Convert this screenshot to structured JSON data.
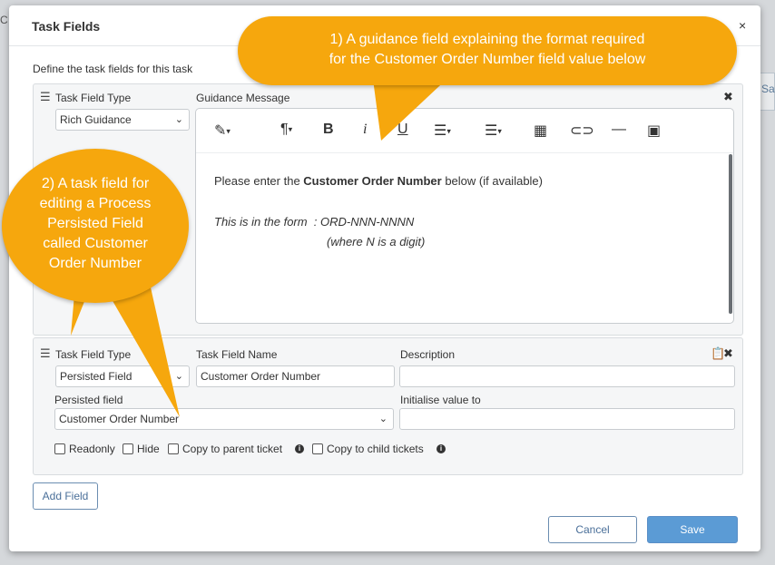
{
  "modal": {
    "title": "Task Fields",
    "close": "×",
    "intro": "Define the task fields for this task"
  },
  "background": {
    "left_char": "C",
    "right_char": "Sa"
  },
  "field1": {
    "type_label": "Task Field Type",
    "type_value": "Rich Guidance",
    "guidance_label": "Guidance Message",
    "editor_lines": [
      {
        "pre": "Please enter the ",
        "bold": "Customer Order Number",
        "post": " below (if available)"
      },
      {
        "text": "This is in the form  : ORD-NNN-NNNN"
      },
      {
        "text": "(where N is a digit)"
      }
    ]
  },
  "toolbar": {
    "items": [
      "pencil-dropdown",
      "paragraph-dropdown",
      "bold",
      "italic",
      "underline",
      "ordered-list",
      "bullet-list",
      "table",
      "link",
      "horizontal-rule",
      "image"
    ],
    "bold_glyph": "B",
    "italic_glyph": "i",
    "underline_glyph": "U"
  },
  "field2": {
    "type_label": "Task Field Type",
    "type_value": "Persisted Field",
    "name_label": "Task Field Name",
    "name_value": "Customer Order Number",
    "description_label": "Description",
    "description_value": "",
    "persisted_label": "Persisted field",
    "persisted_value": "Customer Order Number",
    "initialise_label": "Initialise value to",
    "initialise_value": "",
    "checkboxes": {
      "readonly": "Readonly",
      "hide": "Hide",
      "copy_parent": "Copy to parent ticket",
      "copy_child": "Copy to child tickets"
    }
  },
  "buttons": {
    "add_field": "Add Field",
    "cancel": "Cancel",
    "save": "Save"
  },
  "callouts": {
    "one": [
      "1) A guidance field explaining the format required",
      "for the Customer Order Number field value below"
    ],
    "two": [
      "2) A task field for",
      "editing a Process",
      "Persisted Field",
      "called Customer",
      "Order Number"
    ],
    "color": "#f6a70d"
  },
  "colors": {
    "accent": "#5b9bd5",
    "link": "#4a6f99"
  }
}
